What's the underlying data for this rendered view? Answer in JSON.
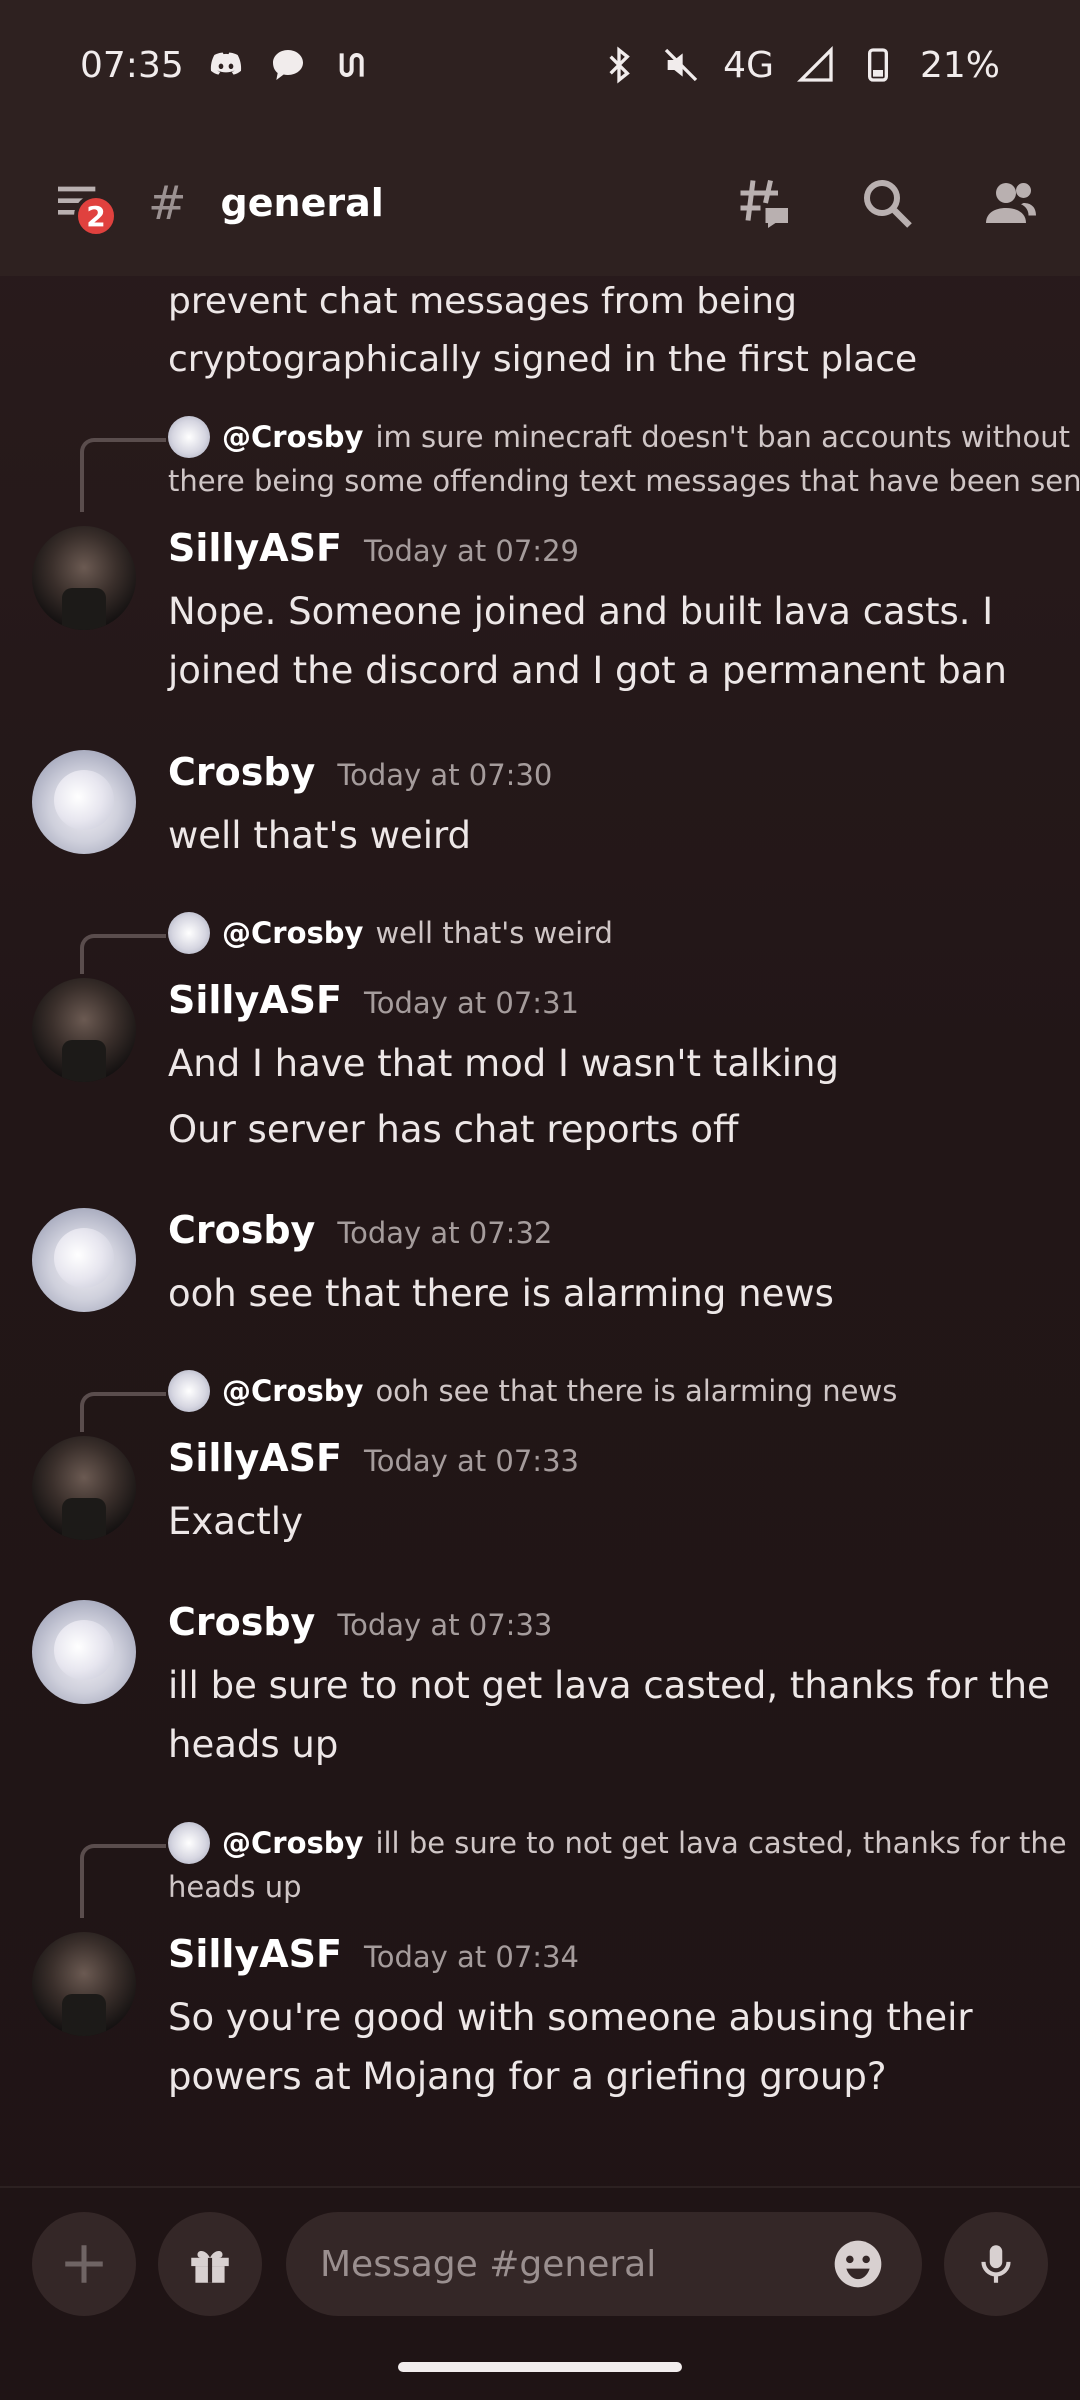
{
  "status_bar": {
    "time": "07:35",
    "network": "4G",
    "battery": "21%",
    "icons_left": [
      "discord-icon",
      "chat-bubble-icon",
      "link-icon"
    ],
    "icons_right": [
      "bluetooth-icon",
      "mute-icon",
      "signal-icon",
      "battery-icon"
    ]
  },
  "header": {
    "notification_count": "2",
    "hash_symbol": "#",
    "channel": "general"
  },
  "clipped_message": {
    "line1": "prevent chat messages from being",
    "line2": "cryptographically signed in the first place"
  },
  "messages": [
    {
      "reply": {
        "mention": "@Crosby",
        "text": "im sure minecraft doesn't ban accounts without",
        "text2": "there being some offending text messages that have been sent"
      },
      "author": "SillyASF",
      "time": "Today at 07:29",
      "lines": [
        "Nope. Someone joined and built lava casts. I",
        "joined the discord and I got a permanent ban"
      ]
    },
    {
      "author": "Crosby",
      "time": "Today at 07:30",
      "lines": [
        "well that's weird"
      ]
    },
    {
      "reply": {
        "mention": "@Crosby",
        "text": "well that's weird"
      },
      "author": "SillyASF",
      "time": "Today at 07:31",
      "lines": [
        "And I have that mod I wasn't talking",
        "Our server has chat reports off"
      ]
    },
    {
      "author": "Crosby",
      "time": "Today at 07:32",
      "lines": [
        "ooh see that there is alarming news"
      ]
    },
    {
      "reply": {
        "mention": "@Crosby",
        "text": "ooh see that there is alarming news"
      },
      "author": "SillyASF",
      "time": "Today at 07:33",
      "lines": [
        "Exactly"
      ]
    },
    {
      "author": "Crosby",
      "time": "Today at 07:33",
      "lines": [
        "ill be sure to not get lava casted, thanks for the",
        "heads up"
      ]
    },
    {
      "reply": {
        "mention": "@Crosby",
        "text": "ill be sure to not get lava casted, thanks for the",
        "text2": "heads up"
      },
      "author": "SillyASF",
      "time": "Today at 07:34",
      "lines": [
        "So you're good with someone abusing their",
        "powers at Mojang for a griefing group?"
      ]
    }
  ],
  "composer": {
    "placeholder": "Message #general"
  },
  "colors": {
    "background": "#221617",
    "header": "#2e2120",
    "badge": "#e0413e",
    "input": "#342727"
  }
}
